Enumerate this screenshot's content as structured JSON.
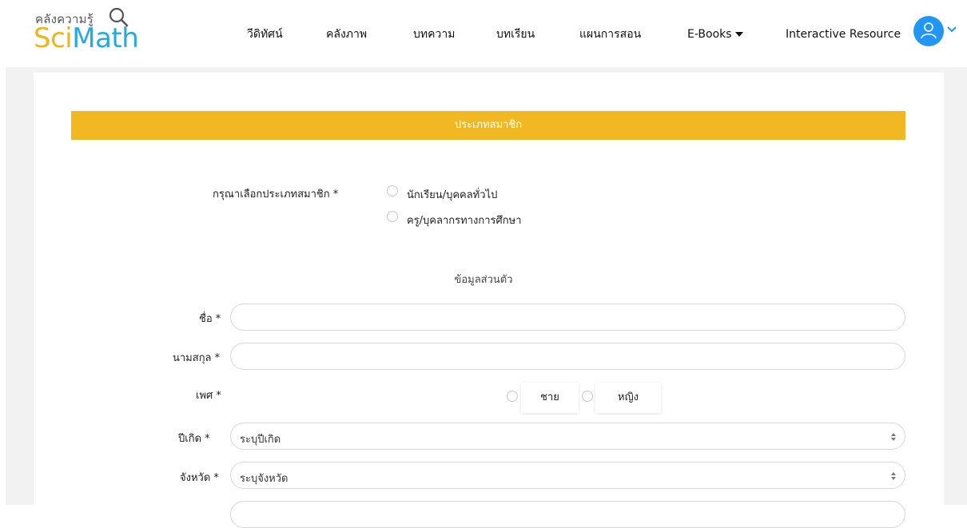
{
  "logo": {
    "top_text": "คลังความรู้",
    "sci": "Sci",
    "math": "Math",
    "glass_icon": "magnifier-icon"
  },
  "nav": {
    "items": [
      {
        "label": "วีดิทัศน์"
      },
      {
        "label": "คลังภาพ"
      },
      {
        "label": "บทความ"
      },
      {
        "label": "บทเรียน"
      },
      {
        "label": "แผนการสอน"
      },
      {
        "label": "E-Books"
      },
      {
        "label": "Interactive Resource"
      }
    ],
    "user_icon": "user-icon",
    "chevron_icon": "chevron-down-icon"
  },
  "form": {
    "section_title": "ประเภทสมาชิก",
    "member_type_label": "กรุณาเลือกประเภทสมาชิก *",
    "member_type_options": [
      "นักเรียน/บุคคลทั่วไป",
      "ครู/บุคลากรทางการศึกษา"
    ],
    "personal_heading": "ข้อมูลส่วนตัว",
    "first_name_label": "ชื่อ *",
    "first_name_value": "",
    "last_name_label": "นามสกุล *",
    "last_name_value": "",
    "gender_label": "เพศ *",
    "gender_options": [
      "ชาย",
      "หญิง"
    ],
    "birth_year_label": "ปีเกิด *",
    "birth_year_value": "ระบุปีเกิด",
    "province_label": "จังหวัด *",
    "province_value": "ระบุจังหวัด"
  },
  "colors": {
    "accent_yellow": "#f2b824",
    "brand_blue": "#26a9e0",
    "avatar_blue": "#2196f3"
  }
}
